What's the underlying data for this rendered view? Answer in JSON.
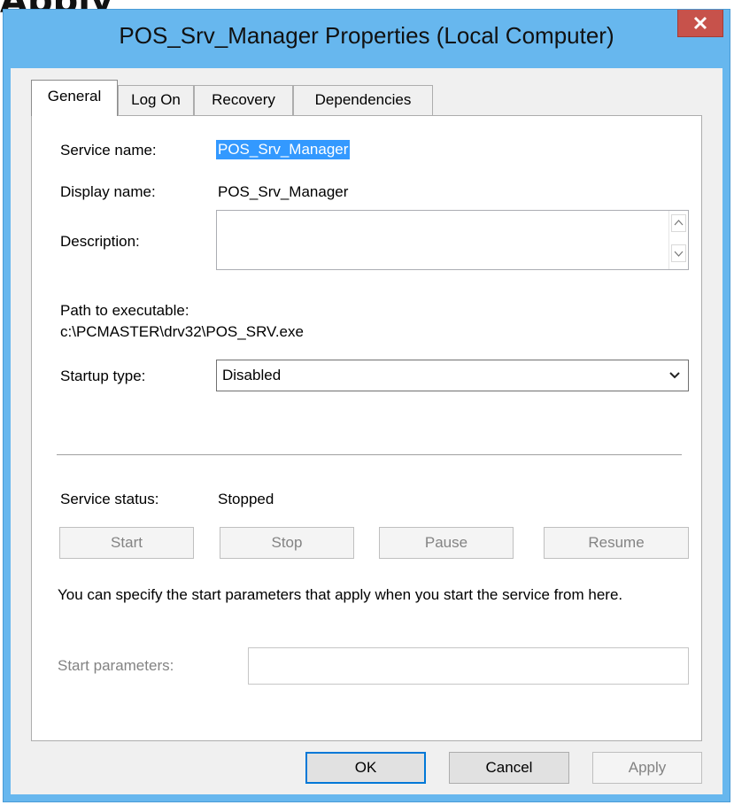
{
  "background_text": "Apply",
  "window": {
    "title": "POS_Srv_Manager Properties (Local Computer)"
  },
  "tabs": [
    "General",
    "Log On",
    "Recovery",
    "Dependencies"
  ],
  "general": {
    "service_name_label": "Service name:",
    "service_name_value": "POS_Srv_Manager",
    "display_name_label": "Display name:",
    "display_name_value": "POS_Srv_Manager",
    "description_label": "Description:",
    "description_value": "",
    "path_label": "Path to executable:",
    "path_value": "c:\\PCMASTER\\drv32\\POS_SRV.exe",
    "startup_type_label": "Startup type:",
    "startup_type_value": "Disabled",
    "service_status_label": "Service status:",
    "service_status_value": "Stopped",
    "buttons": {
      "start": "Start",
      "stop": "Stop",
      "pause": "Pause",
      "resume": "Resume"
    },
    "hint": "You can specify the start parameters that apply when you start the service from here.",
    "start_parameters_label": "Start parameters:",
    "start_parameters_value": ""
  },
  "footer": {
    "ok": "OK",
    "cancel": "Cancel",
    "apply": "Apply"
  },
  "colors": {
    "frame": "#67b7ee",
    "close": "#c7524b",
    "selection": "#3399ff"
  }
}
